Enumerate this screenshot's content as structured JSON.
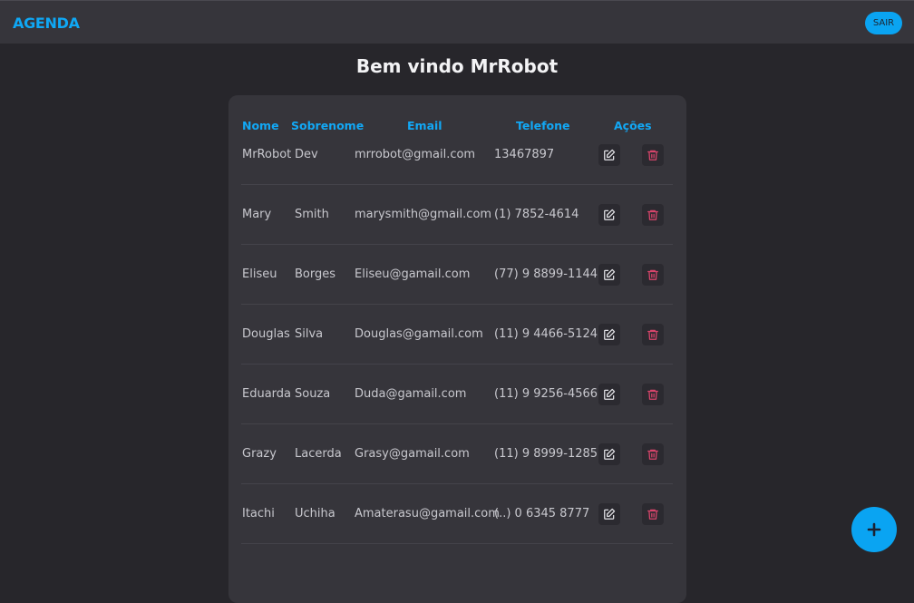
{
  "app": {
    "title": "AGENDA",
    "logout_label": "SAIR"
  },
  "welcome": "Bem vindo MrRobot",
  "table": {
    "headers": {
      "nome": "Nome",
      "sobrenome": "Sobrenome",
      "email": "Email",
      "telefone": "Telefone",
      "acoes": "Ações"
    },
    "rows": [
      {
        "nome": "MrRobot",
        "sobrenome": "Dev",
        "email": "mrrobot@gmail.com",
        "telefone": "13467897"
      },
      {
        "nome": "Mary",
        "sobrenome": "Smith",
        "email": "marysmith@gmail.com",
        "telefone": "(1) 7852-4614"
      },
      {
        "nome": "Eliseu",
        "sobrenome": "Borges",
        "email": "Eliseu@gamail.com",
        "telefone": "(77) 9 8899-1144"
      },
      {
        "nome": "Douglas",
        "sobrenome": "Silva",
        "email": "Douglas@gamail.com",
        "telefone": "(11) 9 4466-5124"
      },
      {
        "nome": "Eduarda",
        "sobrenome": "Souza",
        "email": "Duda@gamail.com",
        "telefone": "(11) 9 9256-4566"
      },
      {
        "nome": "Grazy",
        "sobrenome": "Lacerda",
        "email": "Grasy@gamail.com",
        "telefone": "(11) 9 8999-1285"
      },
      {
        "nome": "Itachi",
        "sobrenome": "Uchiha",
        "email": "Amaterasu@gamail.com",
        "telefone": "(..) 0 6345 8777"
      }
    ]
  },
  "icons": {
    "edit": "edit-icon",
    "delete": "trash-icon",
    "add": "plus-icon"
  },
  "colors": {
    "accent": "#0aa4f2",
    "delete": "#d8456b",
    "background": "#27262b",
    "surface": "#36353b"
  }
}
